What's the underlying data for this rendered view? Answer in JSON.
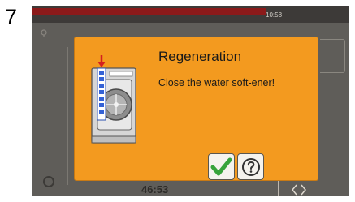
{
  "step_number": "7",
  "status_bar": {
    "time": "10:58",
    "progress": 0.74,
    "progress_color": "#8b1a1a"
  },
  "background": {
    "timer": "46:53"
  },
  "dialog": {
    "title": "Regeneration",
    "message": "Close the water soft-ener!",
    "background_color": "#f39a1f",
    "illustration": "water-softener-icon",
    "buttons": [
      {
        "icon": "checkmark-icon",
        "color": "#37a33b"
      },
      {
        "icon": "help-icon"
      }
    ]
  }
}
